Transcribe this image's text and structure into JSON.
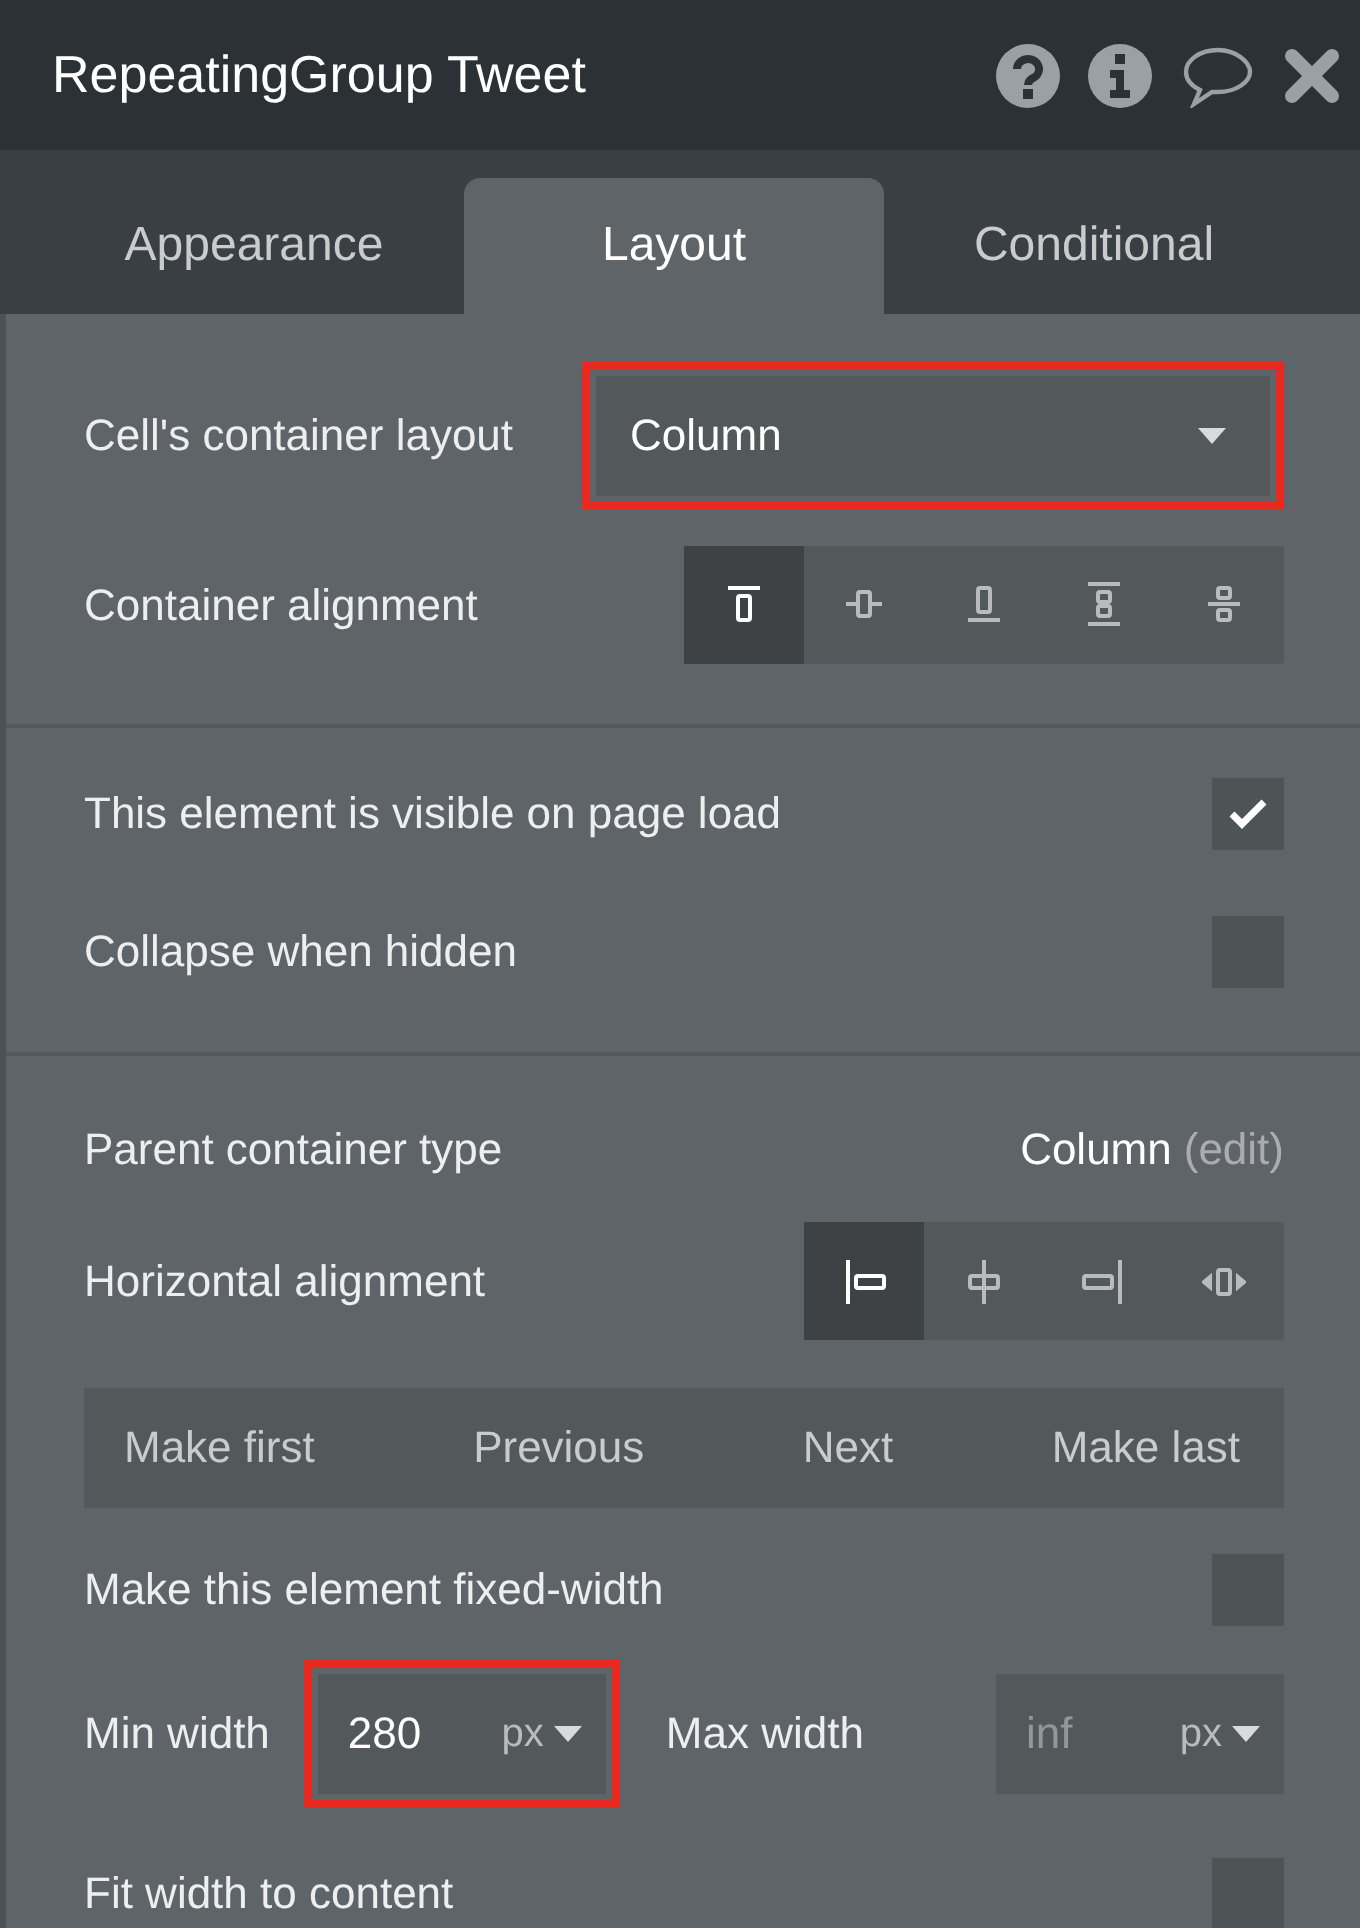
{
  "window": {
    "title": "RepeatingGroup Tweet"
  },
  "tabs": [
    {
      "label": "Appearance",
      "selected": false
    },
    {
      "label": "Layout",
      "selected": true
    },
    {
      "label": "Conditional",
      "selected": false
    }
  ],
  "sections": [
    [
      {
        "kind": "dropdown",
        "label": "Cell's container layout",
        "value": "Column",
        "highlighted": true
      },
      {
        "kind": "segmented",
        "label": "Container alignment",
        "options": [
          {
            "kind": "top",
            "selected": true
          },
          {
            "kind": "center",
            "selected": false
          },
          {
            "kind": "bottom",
            "selected": false
          },
          {
            "kind": "space-between",
            "selected": false
          },
          {
            "kind": "space-around",
            "selected": false
          }
        ]
      }
    ],
    [
      {
        "kind": "checkbox",
        "label": "This element is visible on page load",
        "checked": true
      },
      {
        "kind": "checkbox",
        "label": "Collapse when hidden",
        "checked": false
      }
    ],
    [
      {
        "kind": "info",
        "label": "Parent container type",
        "value": "Column",
        "link": "(edit)"
      },
      {
        "kind": "segmented",
        "label": "Horizontal alignment",
        "options": [
          {
            "kind": "left",
            "selected": true
          },
          {
            "kind": "hcenter",
            "selected": false
          },
          {
            "kind": "right",
            "selected": false
          },
          {
            "kind": "stretch",
            "selected": false
          }
        ]
      },
      {
        "kind": "nav",
        "buttons": [
          "Make first",
          "Previous",
          "Next",
          "Make last"
        ]
      },
      {
        "kind": "checkbox",
        "label": "Make this element fixed-width",
        "checked": false
      },
      {
        "kind": "size",
        "fields": [
          {
            "label": "Min width",
            "value": "280",
            "unit": "px",
            "highlighted": true
          },
          {
            "label": "Max width",
            "placeholder": "inf",
            "unit": "px",
            "highlighted": false
          }
        ]
      },
      {
        "kind": "checkbox",
        "label": "Fit width to content",
        "checked": false
      }
    ]
  ]
}
